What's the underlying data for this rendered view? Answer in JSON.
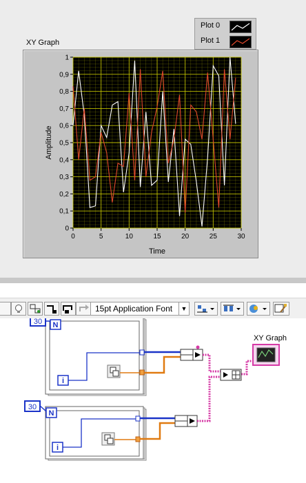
{
  "front_panel": {
    "graph_label": "XY Graph",
    "legend": [
      {
        "name": "Plot 0",
        "color": "#ffffff"
      },
      {
        "name": "Plot 1",
        "color": "#e0482c"
      }
    ]
  },
  "chart_data": {
    "type": "line",
    "xlabel": "Time",
    "ylabel": "Amplitude",
    "xlim": [
      0,
      30
    ],
    "ylim": [
      0,
      1
    ],
    "x_ticks": [
      "0",
      "5",
      "10",
      "15",
      "20",
      "25",
      "30"
    ],
    "y_ticks": [
      "0",
      "0,1",
      "0,2",
      "0,3",
      "0,4",
      "0,5",
      "0,6",
      "0,7",
      "0,8",
      "0,9",
      "1"
    ],
    "grid": true,
    "plot_background": "#000000",
    "grid_color": "#c8c800",
    "series": [
      {
        "name": "Plot 0",
        "color": "#ffffff",
        "x": [
          0,
          1,
          2,
          3,
          4,
          5,
          6,
          7,
          8,
          9,
          10,
          11,
          12,
          13,
          14,
          15,
          16,
          17,
          18,
          19,
          20,
          21,
          22,
          23,
          24,
          25,
          26,
          27,
          28,
          29
        ],
        "y": [
          0.6,
          0.92,
          0.66,
          0.12,
          0.13,
          0.6,
          0.53,
          0.72,
          0.74,
          0.21,
          0.44,
          0.98,
          0.24,
          0.68,
          0.25,
          0.28,
          0.8,
          0.27,
          0.58,
          0.07,
          0.52,
          0.49,
          0.27,
          0.01,
          0.41,
          0.95,
          0.89,
          0.25,
          1.0,
          0.61
        ]
      },
      {
        "name": "Plot 1",
        "color": "#e0482c",
        "x": [
          0,
          1,
          2,
          3,
          4,
          5,
          6,
          7,
          8,
          9,
          10,
          11,
          12,
          13,
          14,
          15,
          16,
          17,
          18,
          19,
          20,
          21,
          22,
          23,
          24,
          25,
          26,
          27,
          28,
          29
        ],
        "y": [
          0.83,
          0.4,
          0.7,
          0.28,
          0.3,
          0.56,
          0.44,
          0.15,
          0.38,
          0.36,
          0.79,
          0.28,
          0.93,
          0.3,
          0.56,
          0.71,
          0.92,
          0.38,
          0.52,
          0.78,
          0.09,
          0.72,
          0.68,
          0.52,
          0.91,
          0.52,
          0.12,
          0.93,
          0.52,
          0.88
        ]
      }
    ]
  },
  "toolbar": {
    "font_select": "15pt Application Font",
    "font_arrow": "▼"
  },
  "block_diagram": {
    "loop1": {
      "count": "30",
      "n_label": "N",
      "i_label": "i"
    },
    "loop2": {
      "count": "30",
      "n_label": "N",
      "i_label": "i"
    },
    "graph_terminal_label": "XY Graph"
  }
}
